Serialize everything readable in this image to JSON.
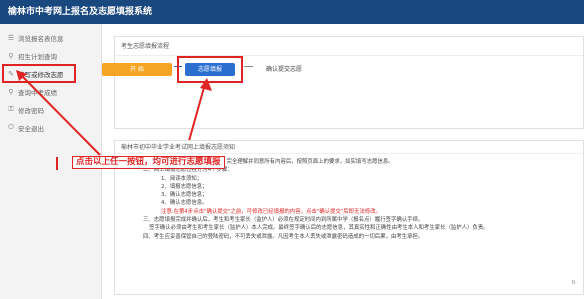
{
  "app": {
    "title": "榆林市中考网上报名及志愿填报系统"
  },
  "sidebar": {
    "items": [
      {
        "icon": "list-icon",
        "label": "浏览报名表信息"
      },
      {
        "icon": "search-icon",
        "label": "招生计划查询"
      },
      {
        "icon": "pencil-icon",
        "label": "填写或修改志愿"
      },
      {
        "icon": "search-icon",
        "label": "查询中考成绩"
      },
      {
        "icon": "lock-icon",
        "label": "修改密码"
      },
      {
        "icon": "power-icon",
        "label": "安全退出"
      }
    ],
    "active_index": 2
  },
  "flow": {
    "title": "考生志愿填报流程",
    "steps": [
      "开 始",
      "志愿填报",
      "确认提交志愿"
    ]
  },
  "notice": {
    "title": "榆林市初中毕业学业考试网上填报志愿须知",
    "lines": [
      "一、考生必须认真阅读本《须知》，完全理解并同意所有内容后，按照页面上的要求，如实填写志愿信息。",
      "二、网上填报志愿过程分为4个步骤：",
      "1、阅读本须知；",
      "2、填报志愿信息；",
      "3、确认志愿信息；",
      "4、确认志愿信息。",
      "注意:在第4步点击\"确认提交\"之前，可修改已经填报的内容，点击\"确认提交\"后即无法修改。",
      "三、志愿填报完成并确认后，考生和考生家长（监护人）必须在规定时间内到所属中学（报名点）履行签字确认手续。",
      "签字确认必须由考生和考生家长（监护人）本人完成。最终签字确认后的志愿信息，其真实性和正确性由考生本人和考生家长（监护人）负责。",
      "四、考生应妥善保管自己的登陆密码，不可丢失或泄露。凡因考生本人丢失或泄露密码造成的一切后果，由考生承担。"
    ],
    "page_marker": "B-"
  },
  "annotation": {
    "callout": "点击以上任一按钮，均可进行志愿填报"
  },
  "colors": {
    "header": "#19487e",
    "highlight": "#e02424",
    "start": "#f5a523",
    "fill": "#2a6fd0"
  }
}
